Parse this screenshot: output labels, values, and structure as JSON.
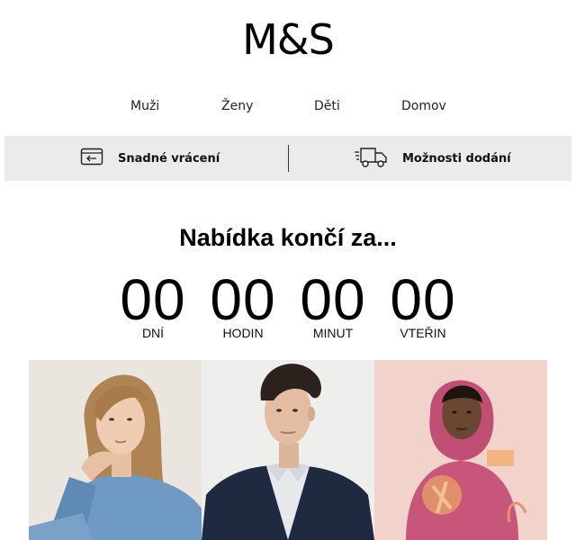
{
  "brand": {
    "logo_text": "M&S"
  },
  "nav": {
    "items": [
      {
        "label": "Muži"
      },
      {
        "label": "Ženy"
      },
      {
        "label": "Děti"
      },
      {
        "label": "Domov"
      }
    ]
  },
  "service_bar": {
    "returns": {
      "label": "Snadné vrácení",
      "icon": "return-card-icon"
    },
    "delivery": {
      "label": "Možnosti dodání",
      "icon": "delivery-truck-icon"
    }
  },
  "offer": {
    "title": "Nabídka končí za...",
    "countdown": [
      {
        "value": "00",
        "label": "DNÍ"
      },
      {
        "value": "00",
        "label": "HODIN"
      },
      {
        "value": "00",
        "label": "MINUT"
      },
      {
        "value": "00",
        "label": "VTEŘIN"
      }
    ]
  },
  "hero": {
    "panels": [
      {
        "name": "women",
        "bg": "#eae6df"
      },
      {
        "name": "men",
        "bg": "#eeeeec"
      },
      {
        "name": "kids",
        "bg": "#f1d3cc"
      }
    ]
  },
  "colors": {
    "service_bar_bg": "#ebebeb",
    "text": "#111111",
    "hoodie_pink": "#c8557a"
  }
}
